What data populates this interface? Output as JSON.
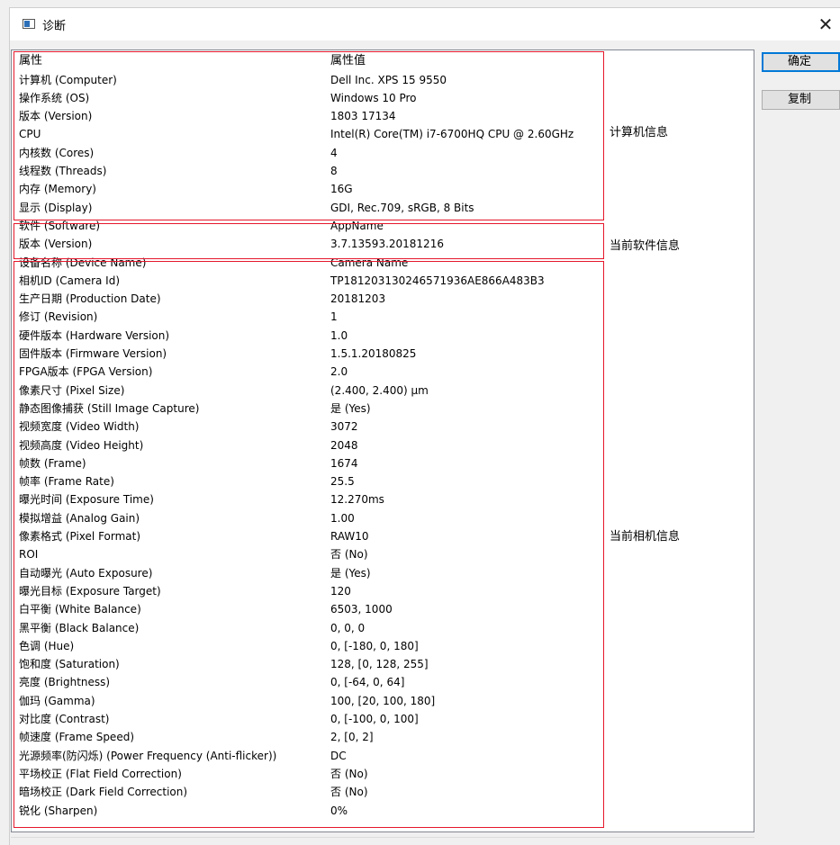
{
  "window": {
    "title": "诊断",
    "close_glyph": "✕",
    "icon": "app-window-icon"
  },
  "header": {
    "property": "属性",
    "value": "属性值"
  },
  "buttons": {
    "ok": "确定",
    "copy": "复制"
  },
  "groups": {
    "computer": {
      "label": "计算机信息",
      "rows": [
        {
          "name": "计算机 (Computer)",
          "value": "Dell Inc. XPS 15 9550"
        },
        {
          "name": "操作系统 (OS)",
          "value": "Windows 10 Pro"
        },
        {
          "name": "版本 (Version)",
          "value": "1803 17134"
        },
        {
          "name": "CPU",
          "value": "Intel(R) Core(TM) i7-6700HQ CPU @ 2.60GHz"
        },
        {
          "name": "内核数 (Cores)",
          "value": "4"
        },
        {
          "name": "线程数 (Threads)",
          "value": "8"
        },
        {
          "name": "内存 (Memory)",
          "value": "16G"
        },
        {
          "name": "显示 (Display)",
          "value": "GDI, Rec.709, sRGB, 8 Bits"
        }
      ]
    },
    "software": {
      "label": "当前软件信息",
      "rows": [
        {
          "name": "软件 (Software)",
          "value": "AppName"
        },
        {
          "name": "版本 (Version)",
          "value": "3.7.13593.20181216"
        }
      ]
    },
    "camera": {
      "label": "当前相机信息",
      "rows": [
        {
          "name": "设备名称 (Device Name)",
          "value": "Camera Name"
        },
        {
          "name": "相机ID (Camera Id)",
          "value": "TP181203130246571936AE866A483B3"
        },
        {
          "name": "生产日期 (Production Date)",
          "value": "20181203"
        },
        {
          "name": "修订 (Revision)",
          "value": "1"
        },
        {
          "name": "硬件版本 (Hardware Version)",
          "value": "1.0"
        },
        {
          "name": "固件版本 (Firmware Version)",
          "value": "1.5.1.20180825"
        },
        {
          "name": "FPGA版本 (FPGA Version)",
          "value": "2.0"
        },
        {
          "name": "像素尺寸 (Pixel Size)",
          "value": "(2.400, 2.400) µm"
        },
        {
          "name": "静态图像捕获 (Still Image Capture)",
          "value": "是 (Yes)"
        },
        {
          "name": "视频宽度 (Video Width)",
          "value": "3072"
        },
        {
          "name": "视频高度 (Video Height)",
          "value": "2048"
        },
        {
          "name": "帧数 (Frame)",
          "value": "1674"
        },
        {
          "name": "帧率 (Frame Rate)",
          "value": "25.5"
        },
        {
          "name": "曝光时间 (Exposure Time)",
          "value": "12.270ms"
        },
        {
          "name": "模拟增益 (Analog Gain)",
          "value": "1.00"
        },
        {
          "name": "像素格式 (Pixel Format)",
          "value": "RAW10"
        },
        {
          "name": "ROI",
          "value": "否 (No)"
        },
        {
          "name": "自动曝光 (Auto Exposure)",
          "value": "是 (Yes)"
        },
        {
          "name": "曝光目标 (Exposure Target)",
          "value": "120"
        },
        {
          "name": "白平衡 (White Balance)",
          "value": "6503, 1000"
        },
        {
          "name": "黑平衡 (Black Balance)",
          "value": "0, 0, 0"
        },
        {
          "name": "色调 (Hue)",
          "value": "0, [-180, 0, 180]"
        },
        {
          "name": "饱和度 (Saturation)",
          "value": "128, [0, 128, 255]"
        },
        {
          "name": "亮度 (Brightness)",
          "value": "0, [-64, 0, 64]"
        },
        {
          "name": "伽玛 (Gamma)",
          "value": "100, [20, 100, 180]"
        },
        {
          "name": "对比度 (Contrast)",
          "value": "0, [-100, 0, 100]"
        },
        {
          "name": "帧速度 (Frame Speed)",
          "value": "2, [0, 2]"
        },
        {
          "name": "光源频率(防闪烁) (Power Frequency (Anti-flicker))",
          "value": "DC"
        },
        {
          "name": "平场校正 (Flat Field Correction)",
          "value": "否 (No)"
        },
        {
          "name": "暗场校正 (Dark Field Correction)",
          "value": "否 (No)"
        },
        {
          "name": "锐化 (Sharpen)",
          "value": "0%"
        }
      ]
    }
  },
  "colors": {
    "highlight_border": "#e5172b",
    "default_button_border": "#0078d7"
  }
}
